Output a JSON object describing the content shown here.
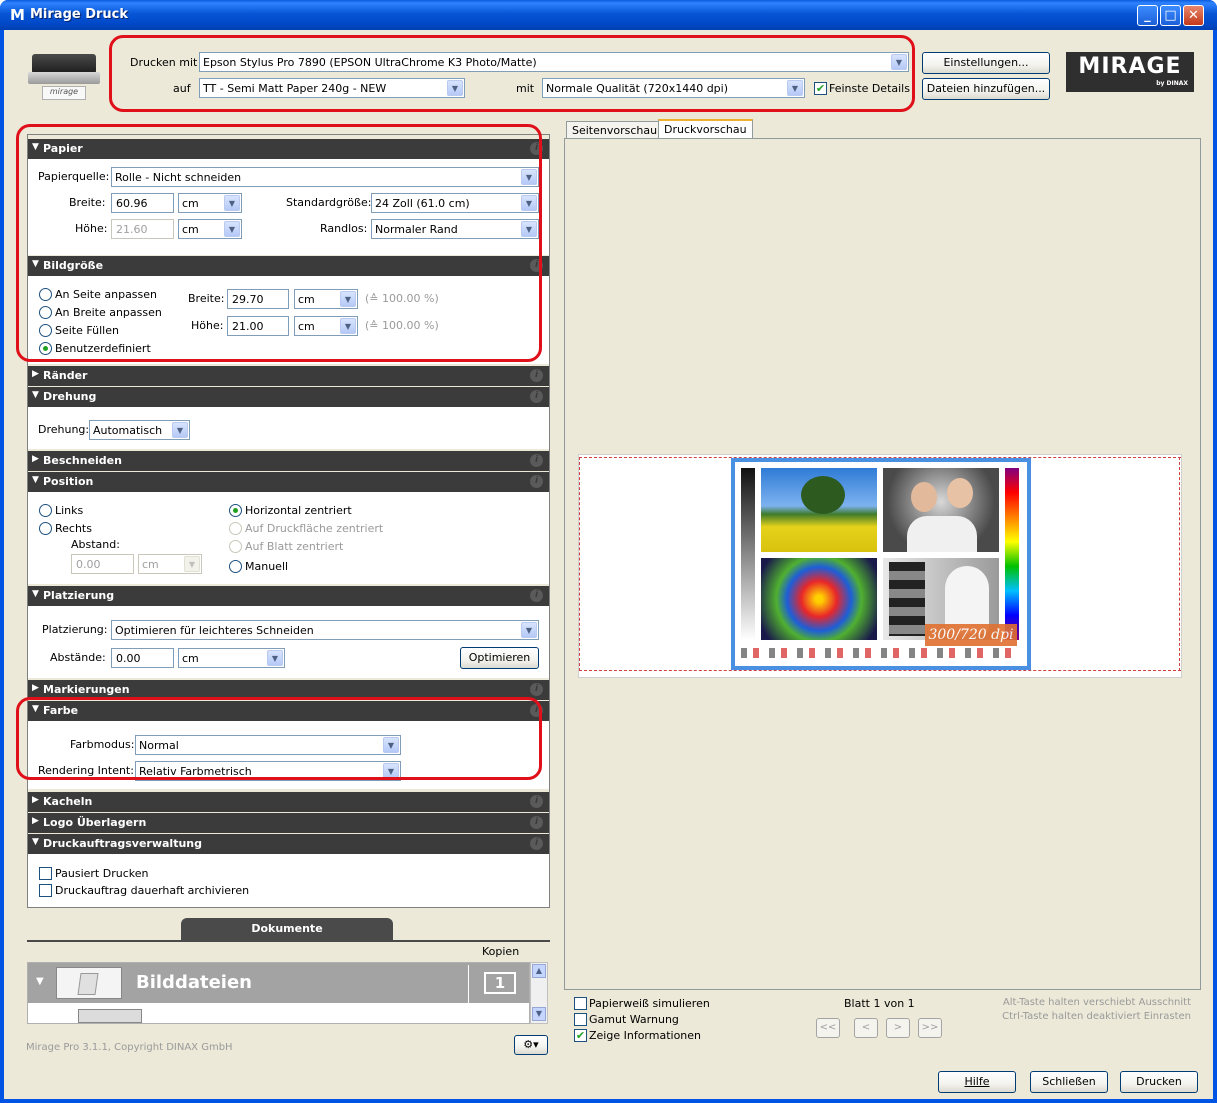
{
  "window": {
    "title": "Mirage Druck",
    "app_icon": "M"
  },
  "top": {
    "printer_label": "Drucken mit",
    "printer_value": "Epson Stylus Pro 7890 (EPSON UltraChrome K3 Photo/Matte)",
    "media_label": "auf",
    "media_value": "TT - Semi Matt Paper 240g - NEW",
    "quality_label": "mit",
    "quality_value": "Normale Qualität (720x1440 dpi)",
    "fine_details_label": "Feinste Details",
    "fine_details_checked": true,
    "settings_button": "Einstellungen...",
    "add_files_button": "Dateien hinzufügen...",
    "printer_thumb_label": "mirage",
    "logo_text": "MIRAGE",
    "logo_sub": "by DINAX"
  },
  "papier": {
    "title": "Papier",
    "source_label": "Papierquelle:",
    "source_value": "Rolle - Nicht schneiden",
    "width_label": "Breite:",
    "width_value": "60.96",
    "width_unit": "cm",
    "height_label": "Höhe:",
    "height_value": "21.60",
    "height_unit": "cm",
    "std_label": "Standardgröße:",
    "std_value": "24 Zoll (61.0 cm)",
    "border_label": "Randlos:",
    "border_value": "Normaler Rand"
  },
  "bildgroesse": {
    "title": "Bildgröße",
    "options": [
      "An Seite anpassen",
      "An Breite anpassen",
      "Seite Füllen",
      "Benutzerdefiniert"
    ],
    "width_label": "Breite:",
    "width_value": "29.70",
    "width_unit": "cm",
    "width_pct": "(≙ 100.00 %)",
    "height_label": "Höhe:",
    "height_value": "21.00",
    "height_unit": "cm",
    "height_pct": "(≙ 100.00 %)"
  },
  "raender": {
    "title": "Ränder"
  },
  "drehung": {
    "title": "Drehung",
    "label": "Drehung:",
    "value": "Automatisch"
  },
  "beschneiden": {
    "title": "Beschneiden"
  },
  "position": {
    "title": "Position",
    "left": "Links",
    "right": "Rechts",
    "distance_label": "Abstand:",
    "distance_value": "0.00",
    "distance_unit": "cm",
    "h_center": "Horizontal zentriert",
    "print_area_center": "Auf Druckfläche zentriert",
    "sheet_center": "Auf Blatt zentriert",
    "manual": "Manuell"
  },
  "platzierung": {
    "title": "Platzierung",
    "label": "Platzierung:",
    "value": "Optimieren für leichteres Schneiden",
    "gap_label": "Abstände:",
    "gap_value": "0.00",
    "gap_unit": "cm",
    "optimize_button": "Optimieren"
  },
  "markierungen": {
    "title": "Markierungen"
  },
  "farbe": {
    "title": "Farbe",
    "mode_label": "Farbmodus:",
    "mode_value": "Normal",
    "intent_label": "Rendering Intent:",
    "intent_value": "Relativ Farbmetrisch"
  },
  "kacheln": {
    "title": "Kacheln"
  },
  "logo": {
    "title": "Logo Überlagern"
  },
  "job": {
    "title": "Druckauftragsverwaltung",
    "pause": "Pausiert Drucken",
    "archive": "Druckauftrag dauerhaft archivieren"
  },
  "documents": {
    "tab": "Dokumente",
    "copies_header": "Kopien",
    "group_name": "Bilddateien",
    "copies": "1"
  },
  "copyright": "Mirage Pro 3.1.1, Copyright DINAX GmbH",
  "preview": {
    "tabs": [
      "Seitenvorschau",
      "Druckvorschau"
    ],
    "active_tab": "Druckvorschau",
    "dpi_badge": "300/720 dpi",
    "simulate_paper_white": "Papierweiß simulieren",
    "gamut_warning": "Gamut Warnung",
    "show_info": "Zeige Informationen",
    "page_info": "Blatt 1 von 1",
    "hint_alt": "Alt-Taste halten verschiebt Ausschnitt",
    "hint_ctrl": "Ctrl-Taste halten deaktiviert Einrasten",
    "nav": [
      "<<",
      "<",
      ">",
      ">>"
    ]
  },
  "footer": {
    "help": "Hilfe",
    "close": "Schließen",
    "print": "Drucken"
  },
  "colors": {
    "section_header": "#3b3b3b",
    "highlight_border": "#e0101a",
    "titlebar": "#0054e3"
  }
}
